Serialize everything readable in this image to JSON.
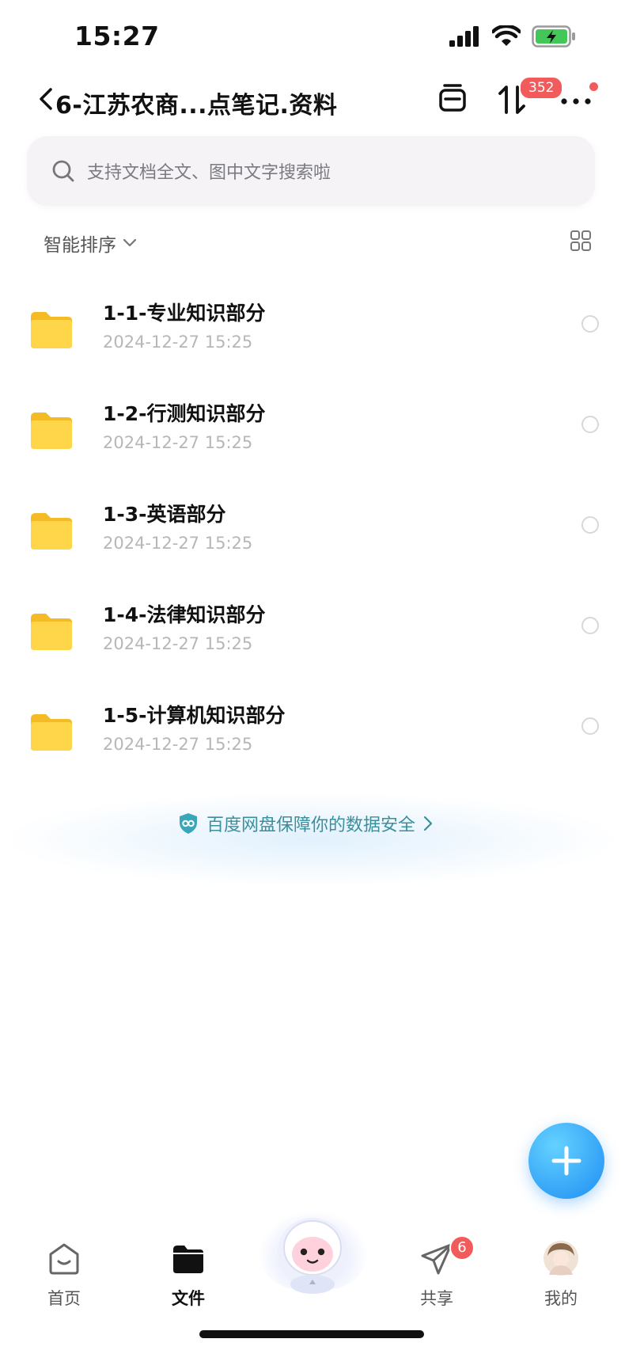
{
  "status_bar": {
    "time": "15:27"
  },
  "nav": {
    "title": "6-江苏农商...点笔记.资料",
    "transfer_badge": "352"
  },
  "search": {
    "placeholder": "支持文档全文、图中文字搜索啦"
  },
  "sort": {
    "label": "智能排序"
  },
  "files": [
    {
      "name": "1-1-专业知识部分",
      "date": "2024-12-27 15:25"
    },
    {
      "name": "1-2-行测知识部分",
      "date": "2024-12-27 15:25"
    },
    {
      "name": "1-3-英语部分",
      "date": "2024-12-27 15:25"
    },
    {
      "name": "1-4-法律知识部分",
      "date": "2024-12-27 15:25"
    },
    {
      "name": "1-5-计算机知识部分",
      "date": "2024-12-27 15:25"
    }
  ],
  "safety": {
    "text": "百度网盘保障你的数据安全"
  },
  "tabs": [
    {
      "label": "首页",
      "icon": "home-icon"
    },
    {
      "label": "文件",
      "icon": "folder-icon"
    },
    {
      "label": "",
      "icon": "mascot-icon"
    },
    {
      "label": "共享",
      "icon": "paper-plane-icon",
      "badge": "6"
    },
    {
      "label": "我的",
      "icon": "avatar"
    }
  ],
  "colors": {
    "accent_blue": "#1e8df3",
    "badge_red": "#f25b5b",
    "folder_yellow": "#ffd54a",
    "safety_teal": "#3a8f9c"
  }
}
